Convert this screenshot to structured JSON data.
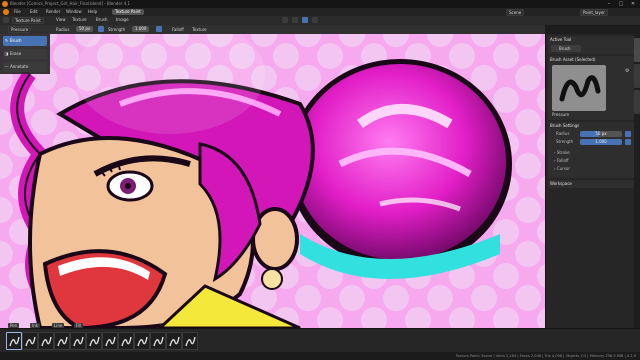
{
  "window": {
    "title": "Blender [Comics_Project_Girl_Hair_Final.blend] - Blender 4.1",
    "controls": [
      "minimize-icon",
      "maximize-icon",
      "close-icon"
    ]
  },
  "menubar": {
    "items": [
      "File",
      "Edit",
      "Render",
      "Window",
      "Help"
    ],
    "workspace_tab": "Texture Paint",
    "scene_label": "Scene",
    "viewlayer_label": "Paint_layer"
  },
  "header": {
    "mode_label": "Texture Paint",
    "menus": [
      "View",
      "Texture",
      "Brush",
      "Image"
    ],
    "brush_name": "Pressure",
    "radius_label": "Radius",
    "radius_value": "50 px",
    "strength_label": "Strength",
    "strength_value": "1.000",
    "falloff_label": "Falloff",
    "texture_label": "Texture",
    "color_accent": "#4772b3"
  },
  "toolbar": {
    "tools": [
      {
        "label": "Brush",
        "icon": "brush-icon",
        "active": true
      },
      {
        "label": "Erase",
        "icon": "eraser-icon",
        "active": false
      },
      {
        "label": "Annotate",
        "icon": "annotate-icon",
        "active": false
      }
    ]
  },
  "sidebar": {
    "active_tool_title": "Active Tool",
    "active_tool_item": "Brush",
    "brush_asset_title": "Brush Asset (Selected)",
    "brush_preview_name": "Pressure",
    "brush_settings_title": "Brush Settings",
    "settings": [
      {
        "label": "Radius",
        "value": "50 px",
        "fill": 0.45
      },
      {
        "label": "Strength",
        "value": "1.000",
        "fill": 1.0
      }
    ],
    "subpanels": [
      "Stroke",
      "Falloff",
      "Cursor"
    ],
    "workspace_title": "Workspace"
  },
  "brushes": {
    "labels": [
      "Pen",
      "Ink",
      "Line",
      "Fill"
    ],
    "count_shown": 12
  },
  "status": {
    "text": "Texture Paint: Scene | Verts 2,184 | Faces 2,048 | Tris 4,096 | Objects 1/3 | Memory 298.5 MiB | 4.1.0"
  }
}
